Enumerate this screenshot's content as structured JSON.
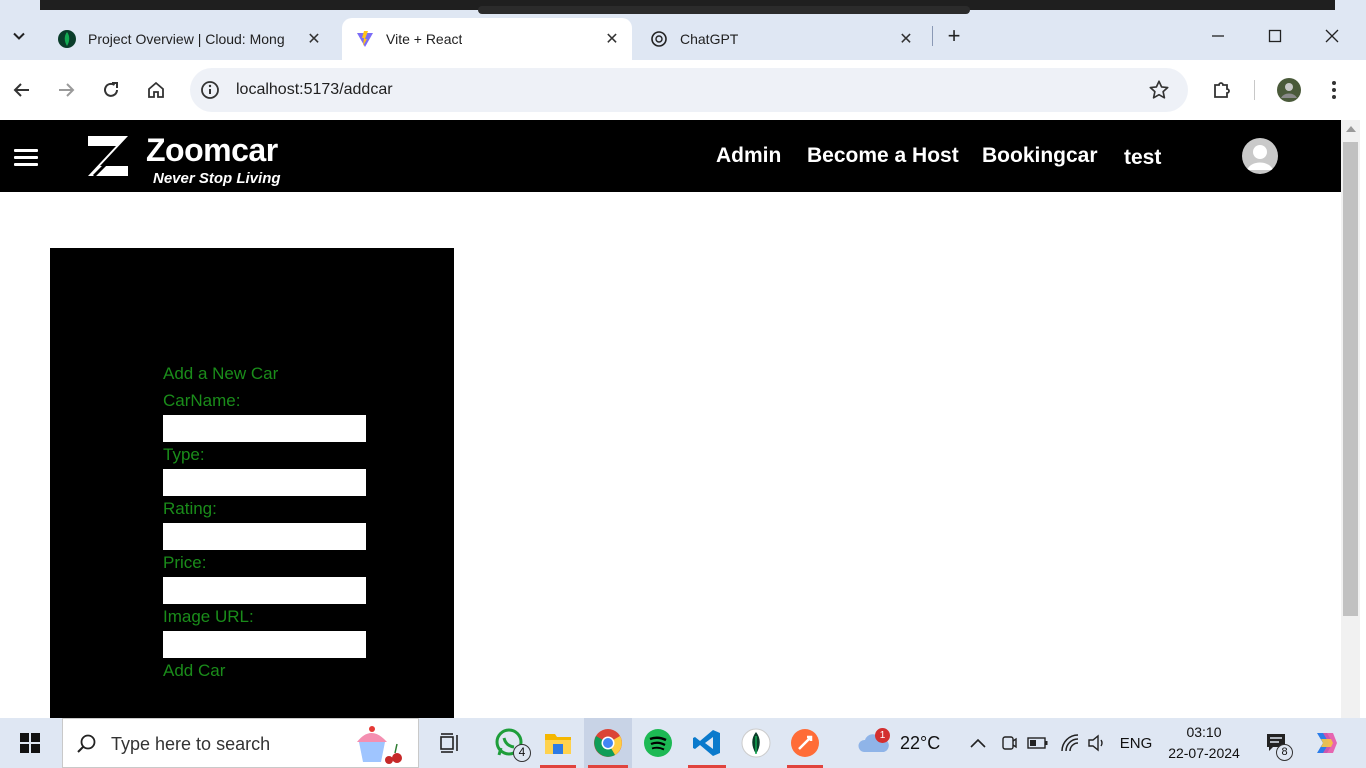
{
  "browser": {
    "tabs": [
      {
        "title": "Project Overview | Cloud: Mong",
        "icon": "mongodb-leaf-icon",
        "active": false
      },
      {
        "title": "Vite + React",
        "icon": "vite-icon",
        "active": true
      },
      {
        "title": "ChatGPT",
        "icon": "chatgpt-icon",
        "active": false
      }
    ],
    "close_glyph": "✕",
    "new_tab_glyph": "+",
    "url": "localhost:5173/addcar"
  },
  "navbar": {
    "brand": "Zoomcar",
    "tagline": "Never Stop Living",
    "links": [
      "Admin",
      "Become a Host",
      "Bookingcar",
      "test"
    ]
  },
  "form": {
    "heading": "Add a New Car",
    "fields": [
      {
        "label": "CarName:",
        "value": ""
      },
      {
        "label": "Type:",
        "value": ""
      },
      {
        "label": "Rating:",
        "value": ""
      },
      {
        "label": "Price:",
        "value": ""
      },
      {
        "label": "Image URL:",
        "value": ""
      }
    ],
    "submit_label": "Add Car",
    "label_color": "#1a8c1a"
  },
  "taskbar": {
    "search_placeholder": "Type here to search",
    "whatsapp_badge": "4",
    "weather": {
      "temp": "22°C",
      "alert_count": "1"
    },
    "language": "ENG",
    "time": "03:10",
    "date": "22-07-2024",
    "notification_count": "8"
  }
}
